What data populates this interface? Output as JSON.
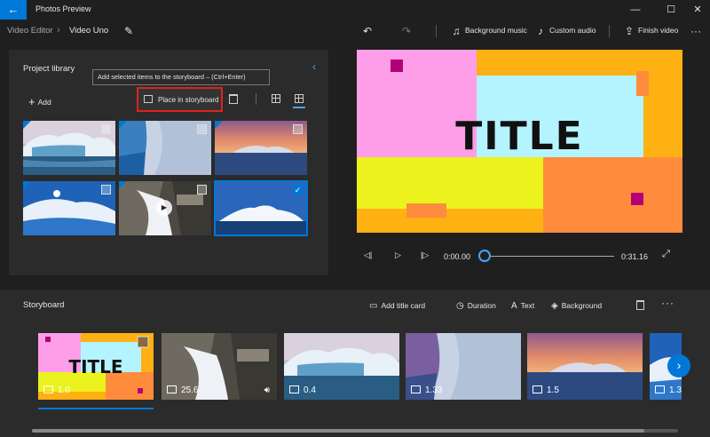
{
  "window": {
    "app_title": "Photos Preview",
    "back_glyph": "←",
    "minimize_glyph": "—",
    "maximize_glyph": "☐",
    "close_glyph": "✕"
  },
  "toolbar": {
    "breadcrumb": [
      "Video Editor",
      "Video Uno"
    ],
    "background_music": "Background music",
    "custom_audio": "Custom audio",
    "finish_video": "Finish video",
    "undo_glyph": "↶",
    "redo_glyph": "↷",
    "edit_glyph": "✎",
    "more_glyph": "···"
  },
  "library": {
    "title": "Project library",
    "add_label": "Add",
    "place_label": "Place in storyboard",
    "tooltip": "Add selected items to the storyboard – (Ctrl+Enter)",
    "collapse_glyph": "‹",
    "play_glyph": "▶",
    "check_glyph": "✓",
    "items": [
      {
        "kind": "photo",
        "selected": false
      },
      {
        "kind": "photo",
        "selected": false
      },
      {
        "kind": "photo",
        "selected": false
      },
      {
        "kind": "photo",
        "selected": false
      },
      {
        "kind": "video",
        "selected": false
      },
      {
        "kind": "photo",
        "selected": true
      }
    ]
  },
  "preview": {
    "title_text": "TITLE",
    "current_time": "0:00.00",
    "total_time": "0:31.16",
    "progress": 0.0,
    "colors": {
      "pink": "#ff9ee8",
      "cyan": "#b4f4ff",
      "yellow": "#ebf21e",
      "orange": "#ffb012",
      "coral": "#ff8c3c",
      "magenta": "#b40078"
    }
  },
  "storyboard": {
    "title": "Storyboard",
    "add_title_card": "Add title card",
    "duration": "Duration",
    "text": "Text",
    "background": "Background",
    "more_glyph": "···",
    "next_glyph": "›",
    "clips": [
      {
        "duration": "1.0",
        "kind": "title",
        "title_text": "TITLE"
      },
      {
        "duration": "25.6",
        "kind": "video"
      },
      {
        "duration": "0.4",
        "kind": "photo"
      },
      {
        "duration": "1.33",
        "kind": "photo"
      },
      {
        "duration": "1.5",
        "kind": "photo"
      },
      {
        "duration": "1.3",
        "kind": "photo"
      }
    ]
  }
}
